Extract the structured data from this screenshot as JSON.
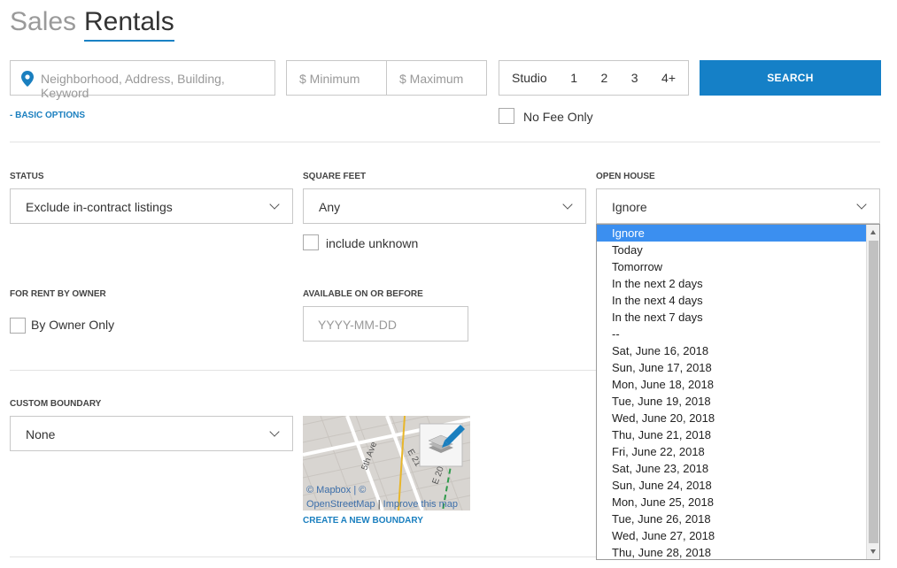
{
  "tabs": {
    "sales": "Sales",
    "rentals": "Rentals"
  },
  "search": {
    "location_placeholder": "Neighborhood, Address, Building, Keyword",
    "min_placeholder": "$ Minimum",
    "max_placeholder": "$ Maximum",
    "beds": [
      "Studio",
      "1",
      "2",
      "3",
      "4+"
    ],
    "button": "SEARCH"
  },
  "basic_options": "- BASIC OPTIONS",
  "no_fee": "No Fee Only",
  "status": {
    "label": "STATUS",
    "value": "Exclude in-contract listings"
  },
  "sqft": {
    "label": "SQUARE FEET",
    "value": "Any",
    "include_unknown": "include unknown"
  },
  "open_house": {
    "label": "OPEN HOUSE",
    "value": "Ignore",
    "options": [
      "Ignore",
      "Today",
      "Tomorrow",
      "In the next 2 days",
      "In the next 4 days",
      "In the next 7 days",
      "--",
      "Sat, June 16, 2018",
      "Sun, June 17, 2018",
      "Mon, June 18, 2018",
      "Tue, June 19, 2018",
      "Wed, June 20, 2018",
      "Thu, June 21, 2018",
      "Fri, June 22, 2018",
      "Sat, June 23, 2018",
      "Sun, June 24, 2018",
      "Mon, June 25, 2018",
      "Tue, June 26, 2018",
      "Wed, June 27, 2018",
      "Thu, June 28, 2018"
    ]
  },
  "by_owner": {
    "label": "FOR RENT BY OWNER",
    "option": "By Owner Only"
  },
  "available": {
    "label": "AVAILABLE ON OR BEFORE",
    "placeholder": "YYYY-MM-DD"
  },
  "boundary": {
    "label": "CUSTOM BOUNDARY",
    "value": "None",
    "map_credit_1": "© Mapbox | ©",
    "map_credit_2": "OpenStreetMap",
    "map_credit_sep": " | ",
    "map_credit_3": "Improve this map",
    "create": "CREATE A NEW BOUNDARY"
  },
  "colors": {
    "accent": "#1580c7",
    "selected": "#3b8ff0"
  }
}
